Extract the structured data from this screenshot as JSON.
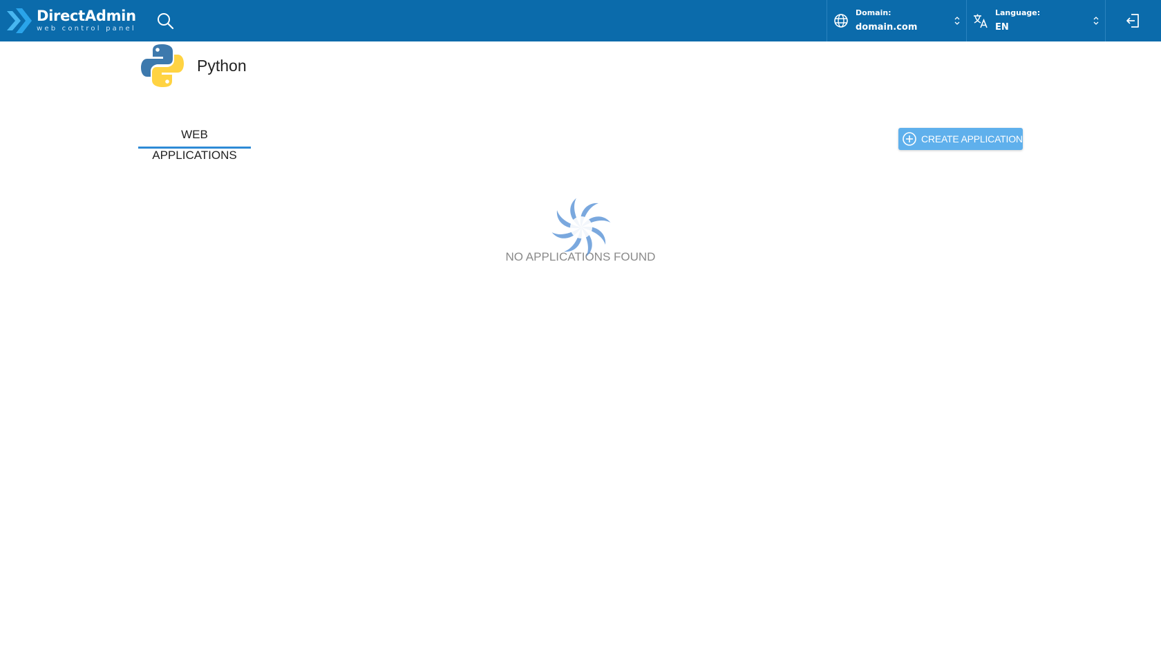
{
  "brand": {
    "name": "DirectAdmin",
    "tagline": "web control panel"
  },
  "topbar": {
    "domain": {
      "label": "Domain:",
      "value": "domain.com"
    },
    "language": {
      "label": "Language:",
      "value": "EN"
    }
  },
  "page": {
    "title": "Python",
    "tab_label": "WEB APPLICATIONS",
    "create_button_label": "CREATE APPLICATION",
    "empty_message": "NO APPLICATIONS FOUND"
  },
  "colors": {
    "topbar": "#0b6bab",
    "accent": "#2d8ad6",
    "button": "#5fb0ec"
  },
  "icons": {
    "search": "search-icon",
    "domain": "globe-icon",
    "language": "translate-icon",
    "logout": "logout-icon",
    "create": "plus-circle-icon",
    "loading": "spinner-icon"
  }
}
